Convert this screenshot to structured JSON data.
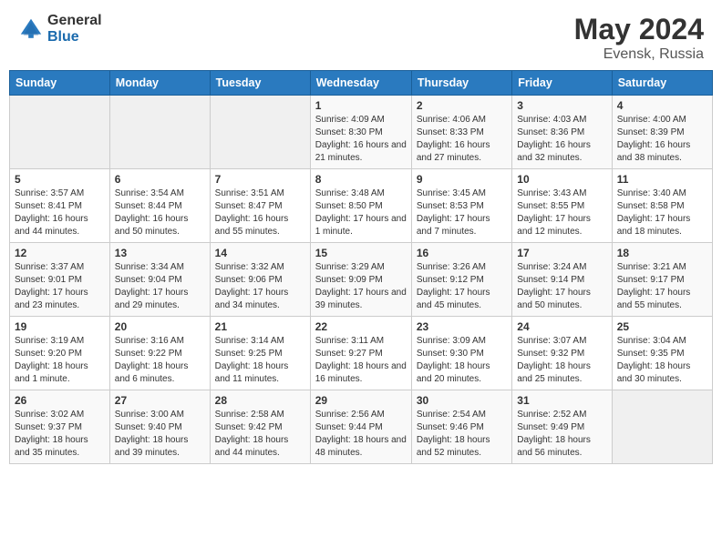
{
  "header": {
    "logo_general": "General",
    "logo_blue": "Blue",
    "title_month": "May 2024",
    "title_location": "Evensk, Russia"
  },
  "weekdays": [
    "Sunday",
    "Monday",
    "Tuesday",
    "Wednesday",
    "Thursday",
    "Friday",
    "Saturday"
  ],
  "weeks": [
    [
      {
        "day": "",
        "info": ""
      },
      {
        "day": "",
        "info": ""
      },
      {
        "day": "",
        "info": ""
      },
      {
        "day": "1",
        "info": "Sunrise: 4:09 AM\nSunset: 8:30 PM\nDaylight: 16 hours and 21 minutes."
      },
      {
        "day": "2",
        "info": "Sunrise: 4:06 AM\nSunset: 8:33 PM\nDaylight: 16 hours and 27 minutes."
      },
      {
        "day": "3",
        "info": "Sunrise: 4:03 AM\nSunset: 8:36 PM\nDaylight: 16 hours and 32 minutes."
      },
      {
        "day": "4",
        "info": "Sunrise: 4:00 AM\nSunset: 8:39 PM\nDaylight: 16 hours and 38 minutes."
      }
    ],
    [
      {
        "day": "5",
        "info": "Sunrise: 3:57 AM\nSunset: 8:41 PM\nDaylight: 16 hours and 44 minutes."
      },
      {
        "day": "6",
        "info": "Sunrise: 3:54 AM\nSunset: 8:44 PM\nDaylight: 16 hours and 50 minutes."
      },
      {
        "day": "7",
        "info": "Sunrise: 3:51 AM\nSunset: 8:47 PM\nDaylight: 16 hours and 55 minutes."
      },
      {
        "day": "8",
        "info": "Sunrise: 3:48 AM\nSunset: 8:50 PM\nDaylight: 17 hours and 1 minute."
      },
      {
        "day": "9",
        "info": "Sunrise: 3:45 AM\nSunset: 8:53 PM\nDaylight: 17 hours and 7 minutes."
      },
      {
        "day": "10",
        "info": "Sunrise: 3:43 AM\nSunset: 8:55 PM\nDaylight: 17 hours and 12 minutes."
      },
      {
        "day": "11",
        "info": "Sunrise: 3:40 AM\nSunset: 8:58 PM\nDaylight: 17 hours and 18 minutes."
      }
    ],
    [
      {
        "day": "12",
        "info": "Sunrise: 3:37 AM\nSunset: 9:01 PM\nDaylight: 17 hours and 23 minutes."
      },
      {
        "day": "13",
        "info": "Sunrise: 3:34 AM\nSunset: 9:04 PM\nDaylight: 17 hours and 29 minutes."
      },
      {
        "day": "14",
        "info": "Sunrise: 3:32 AM\nSunset: 9:06 PM\nDaylight: 17 hours and 34 minutes."
      },
      {
        "day": "15",
        "info": "Sunrise: 3:29 AM\nSunset: 9:09 PM\nDaylight: 17 hours and 39 minutes."
      },
      {
        "day": "16",
        "info": "Sunrise: 3:26 AM\nSunset: 9:12 PM\nDaylight: 17 hours and 45 minutes."
      },
      {
        "day": "17",
        "info": "Sunrise: 3:24 AM\nSunset: 9:14 PM\nDaylight: 17 hours and 50 minutes."
      },
      {
        "day": "18",
        "info": "Sunrise: 3:21 AM\nSunset: 9:17 PM\nDaylight: 17 hours and 55 minutes."
      }
    ],
    [
      {
        "day": "19",
        "info": "Sunrise: 3:19 AM\nSunset: 9:20 PM\nDaylight: 18 hours and 1 minute."
      },
      {
        "day": "20",
        "info": "Sunrise: 3:16 AM\nSunset: 9:22 PM\nDaylight: 18 hours and 6 minutes."
      },
      {
        "day": "21",
        "info": "Sunrise: 3:14 AM\nSunset: 9:25 PM\nDaylight: 18 hours and 11 minutes."
      },
      {
        "day": "22",
        "info": "Sunrise: 3:11 AM\nSunset: 9:27 PM\nDaylight: 18 hours and 16 minutes."
      },
      {
        "day": "23",
        "info": "Sunrise: 3:09 AM\nSunset: 9:30 PM\nDaylight: 18 hours and 20 minutes."
      },
      {
        "day": "24",
        "info": "Sunrise: 3:07 AM\nSunset: 9:32 PM\nDaylight: 18 hours and 25 minutes."
      },
      {
        "day": "25",
        "info": "Sunrise: 3:04 AM\nSunset: 9:35 PM\nDaylight: 18 hours and 30 minutes."
      }
    ],
    [
      {
        "day": "26",
        "info": "Sunrise: 3:02 AM\nSunset: 9:37 PM\nDaylight: 18 hours and 35 minutes."
      },
      {
        "day": "27",
        "info": "Sunrise: 3:00 AM\nSunset: 9:40 PM\nDaylight: 18 hours and 39 minutes."
      },
      {
        "day": "28",
        "info": "Sunrise: 2:58 AM\nSunset: 9:42 PM\nDaylight: 18 hours and 44 minutes."
      },
      {
        "day": "29",
        "info": "Sunrise: 2:56 AM\nSunset: 9:44 PM\nDaylight: 18 hours and 48 minutes."
      },
      {
        "day": "30",
        "info": "Sunrise: 2:54 AM\nSunset: 9:46 PM\nDaylight: 18 hours and 52 minutes."
      },
      {
        "day": "31",
        "info": "Sunrise: 2:52 AM\nSunset: 9:49 PM\nDaylight: 18 hours and 56 minutes."
      },
      {
        "day": "",
        "info": ""
      }
    ]
  ]
}
